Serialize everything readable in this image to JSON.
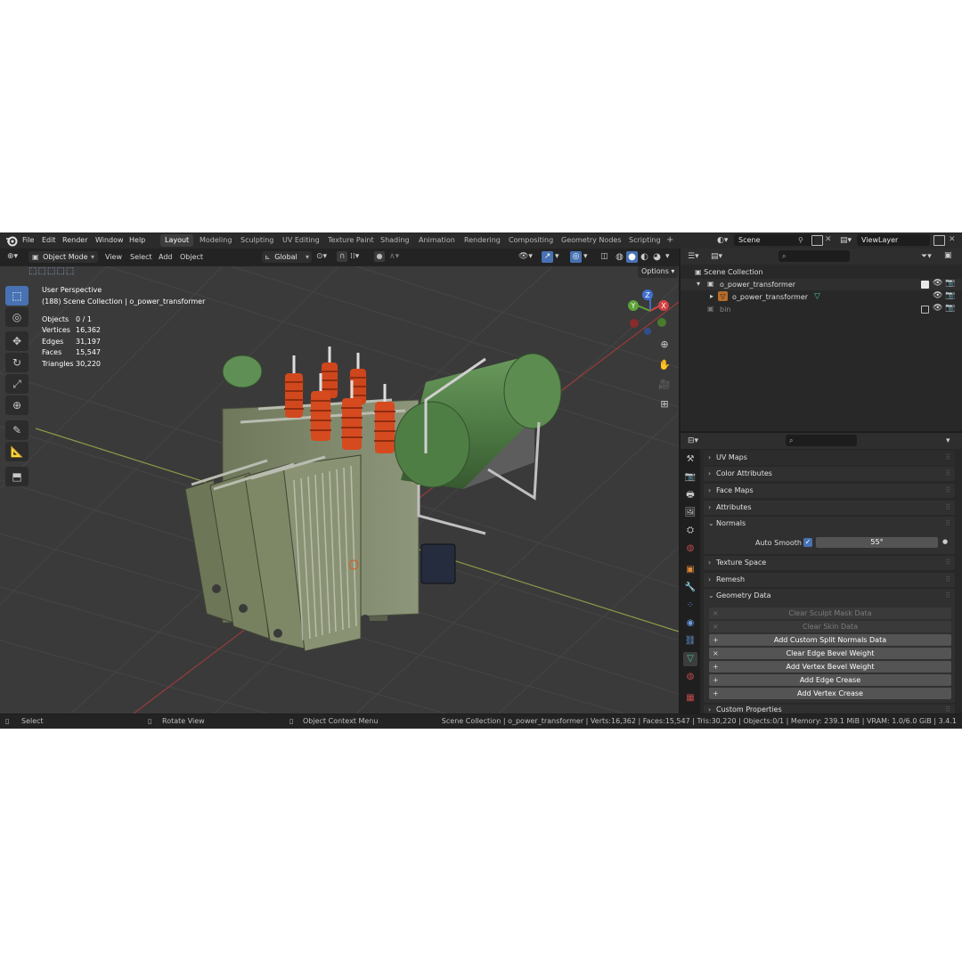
{
  "menu": [
    "File",
    "Edit",
    "Render",
    "Window",
    "Help"
  ],
  "workspace_tabs": [
    "Layout",
    "Modeling",
    "Sculpting",
    "UV Editing",
    "Texture Paint",
    "Shading",
    "Animation",
    "Rendering",
    "Compositing",
    "Geometry Nodes",
    "Scripting"
  ],
  "add_tab": "+",
  "scene": {
    "name": "Scene",
    "view_layer": "ViewLayer"
  },
  "viewport_header": {
    "mode": "Object Mode",
    "menus": [
      "View",
      "Select",
      "Add",
      "Object"
    ],
    "transform_orientation": "Global",
    "options": "Options"
  },
  "viewport": {
    "perspective": "User Perspective",
    "collection_line": "(188) Scene Collection | o_power_transformer",
    "stats": [
      {
        "label": "Objects",
        "value": "0 / 1"
      },
      {
        "label": "Vertices",
        "value": "16,362"
      },
      {
        "label": "Edges",
        "value": "31,197"
      },
      {
        "label": "Faces",
        "value": "15,547"
      },
      {
        "label": "Triangles",
        "value": "30,220"
      }
    ],
    "gizmo_axes": [
      "X",
      "Y",
      "Z"
    ]
  },
  "outliner": {
    "root": "Scene Collection",
    "items": [
      {
        "label": "o_power_transformer",
        "kind": "collection"
      },
      {
        "label": "o_power_transformer",
        "kind": "mesh"
      },
      {
        "label": "bin",
        "kind": "collection"
      }
    ]
  },
  "properties": {
    "panels_top": [
      "UV Maps",
      "Color Attributes",
      "Face Maps",
      "Attributes"
    ],
    "normals": {
      "title": "Normals",
      "auto_smooth_label": "Auto Smooth",
      "auto_smooth_checked": true,
      "angle": "55°"
    },
    "panels_mid": [
      "Texture Space",
      "Remesh"
    ],
    "geometry_data": {
      "title": "Geometry Data",
      "buttons": [
        {
          "label": "Clear Sculpt Mask Data",
          "icon": "×",
          "enabled": false
        },
        {
          "label": "Clear Skin Data",
          "icon": "×",
          "enabled": false
        },
        {
          "label": "Add Custom Split Normals Data",
          "icon": "+",
          "enabled": true
        },
        {
          "label": "Clear Edge Bevel Weight",
          "icon": "×",
          "enabled": true
        },
        {
          "label": "Add Vertex Bevel Weight",
          "icon": "+",
          "enabled": true
        },
        {
          "label": "Add Edge Crease",
          "icon": "+",
          "enabled": true
        },
        {
          "label": "Add Vertex Crease",
          "icon": "+",
          "enabled": true
        }
      ]
    },
    "custom_properties": "Custom Properties"
  },
  "statusbar": {
    "select": "Select",
    "rotate": "Rotate View",
    "context_menu": "Object Context Menu",
    "info": "Scene Collection | o_power_transformer | Verts:16,362 | Faces:15,547 | Tris:30,220 | Objects:0/1 | Memory: 239.1 MiB | VRAM: 1.0/6.0 GiB | 3.4.1"
  },
  "colors": {
    "accent": "#4772b3",
    "tank_green": "#4f7a48",
    "bushing_orange": "#d2481e",
    "body": "#7b8466"
  }
}
